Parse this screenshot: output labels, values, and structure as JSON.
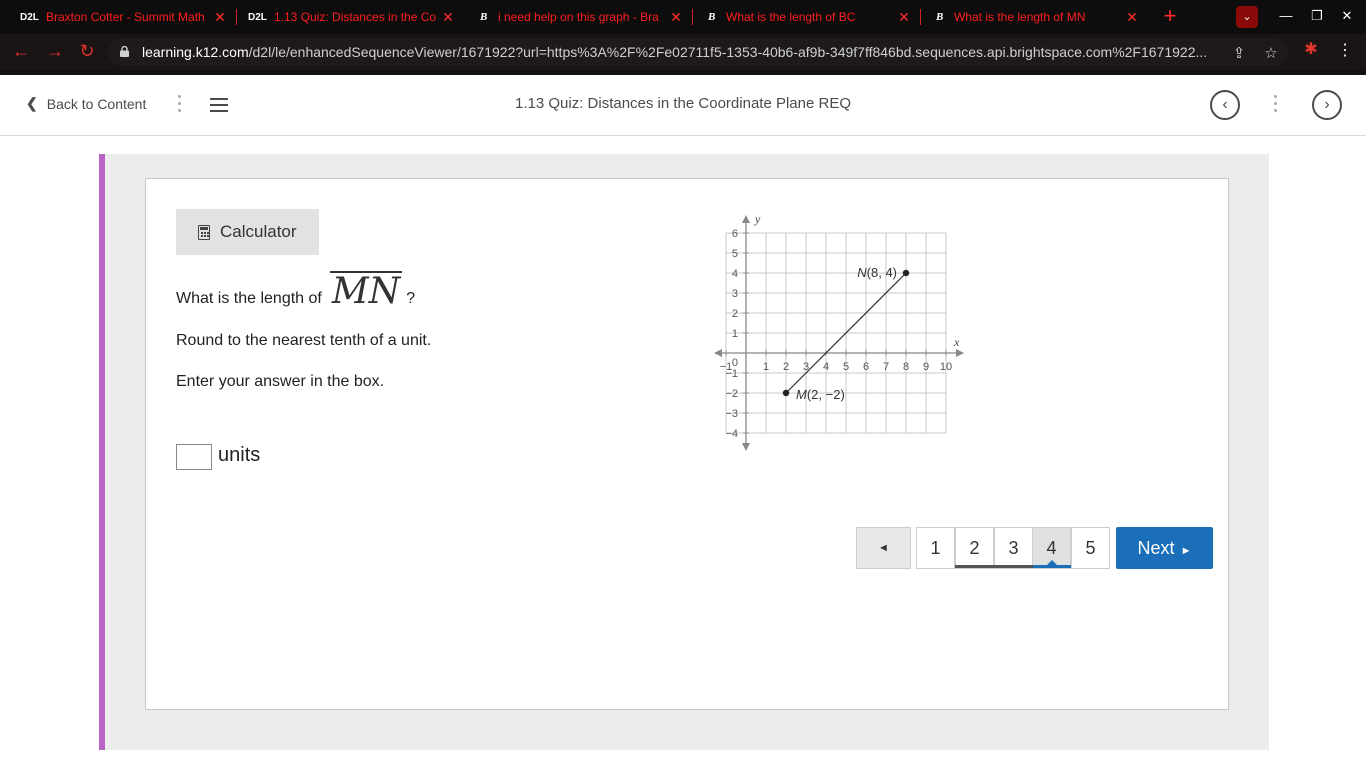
{
  "browser": {
    "tabs": [
      {
        "favicon": "D2L",
        "title": "Braxton Cotter - Summit Math"
      },
      {
        "favicon": "D2L",
        "title": "1.13 Quiz: Distances in the Co"
      },
      {
        "favicon": "B",
        "title": "i need help on this graph - Bra"
      },
      {
        "favicon": "B",
        "title": "What is the length of BC"
      },
      {
        "favicon": "B",
        "title": "What is the length of MN"
      }
    ],
    "url_host": "learning.k12.com",
    "url_path": "/d2l/le/enhancedSequenceViewer/1671922?url=https%3A%2F%2Fe02711f5-1353-40b6-af9b-349f7ff846bd.sequences.api.brightspace.com%2F1671922..."
  },
  "navbar": {
    "back_label": "Back to Content",
    "title": "1.13 Quiz: Distances in the Coordinate Plane REQ"
  },
  "question": {
    "calculator_label": "Calculator",
    "prompt": "What is the length of",
    "segment": "MN",
    "prompt_end": "?",
    "round_text": "Round to the nearest tenth of a unit.",
    "enter_text": "Enter your answer in the box.",
    "answer_value": "",
    "units_label": "units"
  },
  "graph": {
    "x_axis_label": "x",
    "y_axis_label": "y",
    "x_ticks": [
      "−1",
      "1",
      "2",
      "3",
      "4",
      "5",
      "6",
      "7",
      "8",
      "9",
      "10"
    ],
    "y_ticks": [
      "6",
      "5",
      "4",
      "3",
      "2",
      "1",
      "−1",
      "−2",
      "−3",
      "−4"
    ],
    "origin_label": "0",
    "xlim": [
      -1,
      10
    ],
    "ylim": [
      -4,
      6
    ],
    "points": [
      {
        "label_name": "N",
        "label_coords": "(8, 4)",
        "x": 8,
        "y": 4
      },
      {
        "label_name": "M",
        "label_coords": "(2, −2)",
        "x": 2,
        "y": -2
      }
    ]
  },
  "pagination": {
    "prev_symbol": "◄",
    "pages": [
      "1",
      "2",
      "3",
      "4",
      "5"
    ],
    "active_page": "4",
    "next_label": "Next",
    "next_symbol": "►"
  }
}
